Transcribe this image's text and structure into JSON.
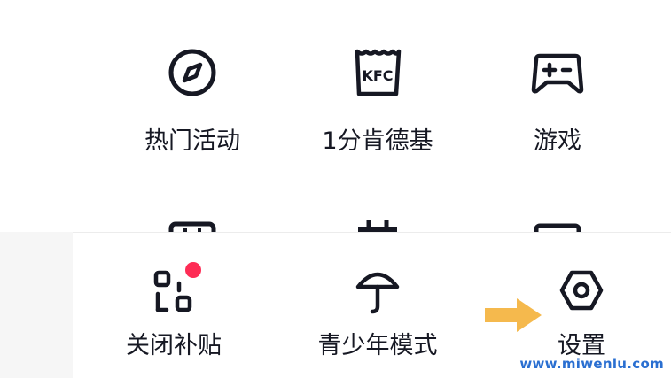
{
  "top_grid": {
    "items": [
      {
        "label": "热门活动",
        "icon": "compass-icon"
      },
      {
        "label": "1分肯德基",
        "icon": "kfc-bucket-icon",
        "icon_text": "KFC"
      },
      {
        "label": "游戏",
        "icon": "gamepad-icon"
      }
    ],
    "partial_row_icons": [
      "wallet-icon",
      "bag-icon",
      "card-icon"
    ]
  },
  "bottom_sheet": {
    "items": [
      {
        "label": "关闭补贴",
        "icon": "qr-grid-icon",
        "badge": true
      },
      {
        "label": "青少年模式",
        "icon": "umbrella-icon"
      },
      {
        "label": "设置",
        "icon": "hexagon-gear-icon"
      }
    ]
  },
  "annotation": {
    "arrow_color": "#f5b94d"
  },
  "watermark": {
    "text": "www.miwenlu.com",
    "color": "#2a6fd1"
  },
  "colors": {
    "badge": "#fe2c55",
    "text": "#161823",
    "background": "#f6f6f6"
  }
}
